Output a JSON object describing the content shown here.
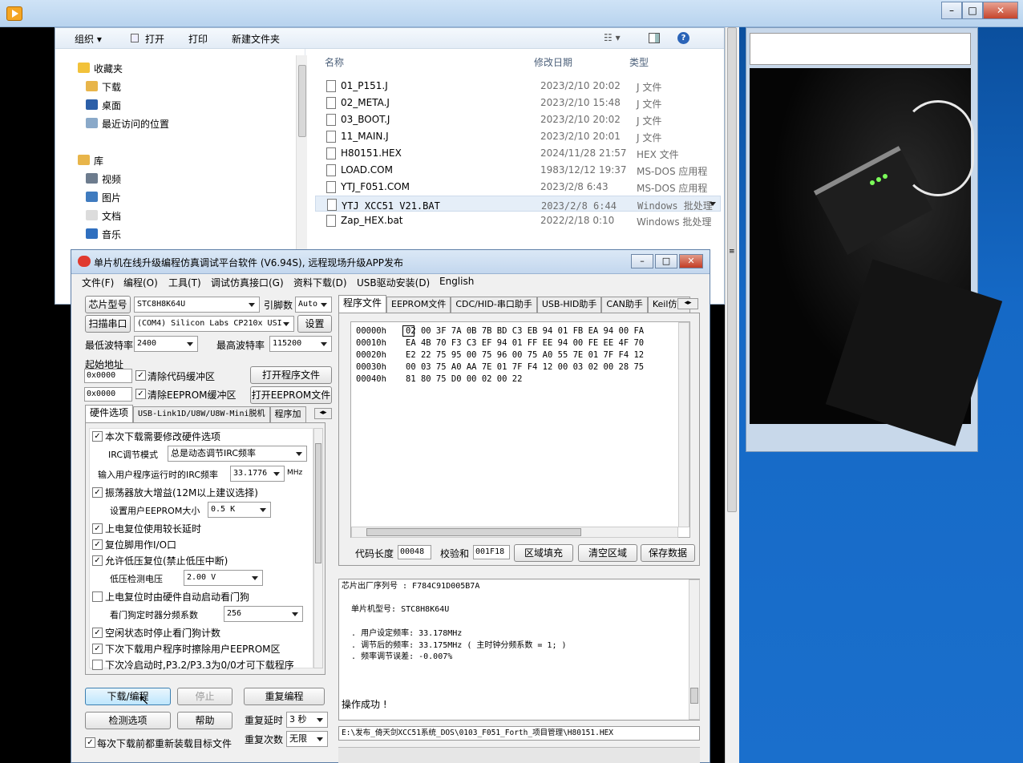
{
  "explorer": {
    "toolbar": {
      "organize": "组织 ▾",
      "open": "打开",
      "print": "打印",
      "new_folder": "新建文件夹"
    },
    "nav": [
      {
        "label": "收藏夹",
        "color": "#f2c23a"
      },
      {
        "label": "下载",
        "color": "#e8b54a"
      },
      {
        "label": "桌面",
        "color": "#2c5fa8"
      },
      {
        "label": "最近访问的位置",
        "color": "#8aa9c9"
      },
      {
        "label": "库",
        "color": "#e8b54a"
      },
      {
        "label": "视频",
        "color": "#6d7c8e"
      },
      {
        "label": "图片",
        "color": "#3f7bbf"
      },
      {
        "label": "文档",
        "color": "#dcdcdc"
      },
      {
        "label": "音乐",
        "color": "#2f6fbf"
      }
    ],
    "columns": {
      "name": "名称",
      "date": "修改日期",
      "type": "类型"
    },
    "files": [
      {
        "name": "01_P151.J",
        "date": "2023/2/10 20:02",
        "type": "J 文件"
      },
      {
        "name": "02_META.J",
        "date": "2023/2/10 15:48",
        "type": "J 文件"
      },
      {
        "name": "03_BOOT.J",
        "date": "2023/2/10 20:02",
        "type": "J 文件"
      },
      {
        "name": "11_MAIN.J",
        "date": "2023/2/10 20:01",
        "type": "J 文件"
      },
      {
        "name": "H80151.HEX",
        "date": "2024/11/28 21:57",
        "type": "HEX 文件"
      },
      {
        "name": "LOAD.COM",
        "date": "1983/12/12 19:37",
        "type": "MS-DOS 应用程"
      },
      {
        "name": "YTJ_F051.COM",
        "date": "2023/2/8 6:43",
        "type": "MS-DOS 应用程"
      },
      {
        "name": "YTJ_XCC51_V21.BAT",
        "date": "2023/2/8 6:44",
        "type": "Windows 批处理"
      },
      {
        "name": "Zap_HEX.bat",
        "date": "2022/2/18 0:10",
        "type": "Windows 批处理"
      }
    ]
  },
  "app": {
    "title": "单片机在线升级编程仿真调试平台软件 (V6.94S), 远程现场升级APP发布",
    "menu": [
      "文件(F)",
      "编程(O)",
      "工具(T)",
      "调试仿真接口(G)",
      "资料下载(D)",
      "USB驱动安装(D)",
      "English"
    ],
    "chip_type_btn": "芯片型号",
    "chip_type": "STC8H8K64U",
    "pin_label": "引脚数",
    "pin_value": "Auto",
    "scan_btn": "扫描串口",
    "port_value": "(COM4) Silicon Labs CP210x USI",
    "settings_btn": "设置",
    "min_baud_label": "最低波特率",
    "min_baud": "2400",
    "max_baud_label": "最高波特率",
    "max_baud": "115200",
    "start_addr_label": "起始地址",
    "code_addr": "0x0000",
    "clear_code_label": "清除代码缓冲区",
    "open_prog_btn": "打开程序文件",
    "eeprom_addr": "0x0000",
    "clear_eeprom_label": "清除EEPROM缓冲区",
    "open_eeprom_btn": "打开EEPROM文件",
    "left_tabs": [
      "硬件选项",
      "USB-Link1D/U8W/U8W-Mini脱机",
      "程序加"
    ],
    "hw": {
      "opt1": "本次下载需要修改硬件选项",
      "irc_mode_label": "IRC调节模式",
      "irc_mode": "总是动态调节IRC频率",
      "irc_freq_label": "输入用户程序运行时的IRC频率",
      "irc_freq": "33.1776",
      "irc_unit": "MHz",
      "opt2": "振荡器放大增益(12M以上建议选择)",
      "eeprom_size_label": "设置用户EEPROM大小",
      "eeprom_size": "0.5 K",
      "opt3": "上电复位使用较长延时",
      "opt4": "复位脚用作I/O口",
      "opt5": "允许低压复位(禁止低压中断)",
      "lvd_label": "低压检测电压",
      "lvd": "2.00 V",
      "opt6": "上电复位时由硬件自动启动看门狗",
      "wdt_label": "看门狗定时器分频系数",
      "wdt": "256",
      "opt7": "空闲状态时停止看门狗计数",
      "opt8": "下次下载用户程序时擦除用户EEPROM区",
      "opt9": "下次冷启动时,P3.2/P3.3为0/0才可下载程序"
    },
    "download_btn": "下载/编程",
    "stop_btn": "停止",
    "reprogram_btn": "重复编程",
    "detect_btn": "检测选项",
    "help_btn": "帮助",
    "repeat_delay_label": "重复延时",
    "repeat_delay": "3 秒",
    "repeat_count_label": "重复次数",
    "repeat_count": "无限",
    "reload_label": "每次下载前都重新装载目标文件",
    "right_tabs": [
      "程序文件",
      "EEPROM文件",
      "CDC/HID-串口助手",
      "USB-HID助手",
      "CAN助手",
      "Keil仿真"
    ],
    "hex_rows": [
      {
        "addr": "00000h",
        "bytes": "02 00 3F 7A 0B 7B BD C3 EB 94 01 FB EA 94 00 FA"
      },
      {
        "addr": "00010h",
        "bytes": "EA 4B 70 F3 C3 EF 94 01 FF EE 94 00 FE EE 4F 70"
      },
      {
        "addr": "00020h",
        "bytes": "E2 22 75 95 00 75 96 00 75 A0 55 7E 01 7F F4 12"
      },
      {
        "addr": "00030h",
        "bytes": "00 03 75 A0 AA 7E 01 7F F4 12 00 03 02 00 28 75"
      },
      {
        "addr": "00040h",
        "bytes": "81 80 75 D0 00 02 00 22"
      }
    ],
    "code_len_label": "代码长度",
    "code_len": "00048",
    "checksum_label": "校验和",
    "checksum": "001F18",
    "fill_btn": "区域填充",
    "clear_btn": "清空区域",
    "save_btn": "保存数据",
    "info": [
      "芯片出厂序列号 : F784C91D005B7A",
      "",
      "  单片机型号: STC8H8K64U",
      "",
      "  . 用户设定频率: 33.178MHz",
      "  . 调节后的频率: 33.175MHz ( 主时钟分频系数 = 1; )",
      "  . 频率调节误差: -0.007%",
      "",
      "",
      "",
      "操作成功 !"
    ],
    "path": "E:\\发布_倚天剑XCC51系统_DOS\\0103_F051_Forth_项目管理\\H80151.HEX"
  }
}
